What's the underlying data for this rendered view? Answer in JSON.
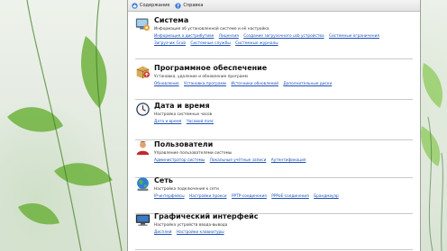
{
  "toolbar": {
    "contents_label": "Содержание",
    "help_label": "Справка"
  },
  "sections": [
    {
      "title": "Система",
      "desc": "Информация об установленной системе и её настройка",
      "links": [
        "Информация о дистрибутиве",
        "Лицензия",
        "Создание загрузочного usb устройства",
        "Системные ограничения",
        "Загрузчик Grub",
        "Системные службы",
        "Системные журналы"
      ]
    },
    {
      "title": "Программное обеспечение",
      "desc": "Установка, удаление и обновление программ",
      "links": [
        "Обновление",
        "Установка программ",
        "Источники обновлений",
        "Дополнительные диски"
      ]
    },
    {
      "title": "Дата и время",
      "desc": "Настройка системных часов",
      "links": [
        "Дата и время",
        "Часовой пояс"
      ]
    },
    {
      "title": "Пользователи",
      "desc": "Управление пользователями системы",
      "links": [
        "Администратор системы",
        "Локальные учётные записи",
        "Аутентификация"
      ]
    },
    {
      "title": "Сеть",
      "desc": "Настройка подключения к сети",
      "links": [
        "IP-интерфейсы",
        "Настройки прокси",
        "PPTP-соединения",
        "PPPoE-соединения",
        "Брандмауэр"
      ]
    },
    {
      "title": "Графический интерфейс",
      "desc": "Настройка устройств ввода-вывода",
      "links": [
        "Дисплей",
        "Настройки клавиатуры"
      ]
    }
  ],
  "icons": {
    "section0": "system-settings-icon",
    "section1": "software-package-icon",
    "section2": "clock-icon",
    "section3": "users-icon",
    "section4": "network-globe-icon",
    "section5": "display-icon"
  }
}
